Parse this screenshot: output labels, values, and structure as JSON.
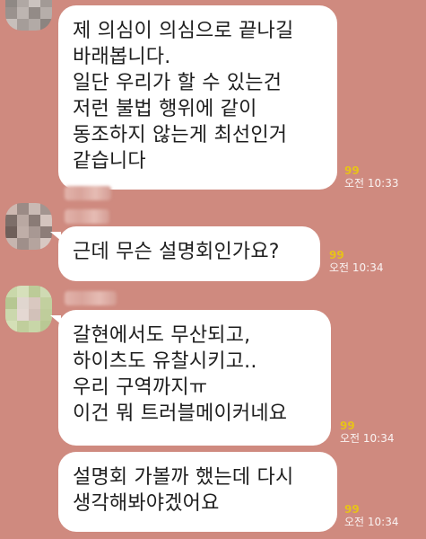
{
  "messages": [
    {
      "lines": [
        "제 의심이 의심으로 끝나길",
        "바래봅니다.",
        "일단 우리가 할 수 있는건",
        "저런 불법 행위에 같이",
        "동조하지 않는게 최선인거",
        "같습니다"
      ],
      "unread": "99",
      "time": "오전 10:33"
    },
    {
      "lines": [
        "근데 무슨 설명회인가요?"
      ],
      "unread": "99",
      "time": "오전 10:34"
    },
    {
      "lines": [
        "갈현에서도 무산되고,",
        "하이츠도 유찰시키고..",
        "우리 구역까지ㅠ",
        "이건 뭐 트러블메이커네요"
      ],
      "unread": "99",
      "time": "오전 10:34"
    },
    {
      "lines": [
        "설명회 가볼까 했는데 다시",
        "생각해봐야겠어요"
      ],
      "unread": "99",
      "time": "오전 10:34"
    }
  ],
  "colors": {
    "background": "#cf8a7f",
    "bubble": "#ffffff",
    "unread": "#e7c21a"
  }
}
